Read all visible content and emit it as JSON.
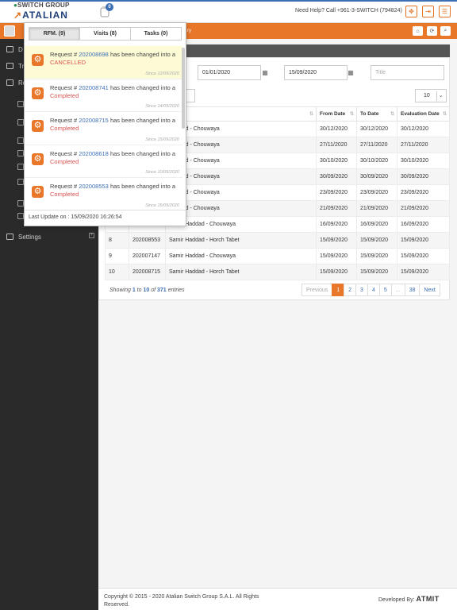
{
  "header": {
    "logo_line1": "SWITCH GROUP",
    "logo_line2": "ATALIAN",
    "notif_count": "0",
    "help_text": "Need Help? Call +961-3-SWITCH (794824)"
  },
  "orange_bar": {
    "partial_text": "ry"
  },
  "sidebar": {
    "items": [
      {
        "label": "D"
      },
      {
        "label": "Tr"
      },
      {
        "label": "Re"
      },
      {
        "label": "Settings"
      }
    ]
  },
  "filters": {
    "from_date": "01/01/2020",
    "to_date": "15/09/2020",
    "title_placeholder": "Title",
    "page_size": "10"
  },
  "table": {
    "columns": [
      "",
      "",
      "",
      "From Date",
      "To Date",
      "Evaluation Date"
    ],
    "rows": [
      [
        "",
        "",
        "Haddad - Chouwaya",
        "30/12/2020",
        "30/12/2020",
        "30/12/2020"
      ],
      [
        "",
        "",
        "Haddad - Chouwaya",
        "27/11/2020",
        "27/11/2020",
        "27/11/2020"
      ],
      [
        "",
        "",
        "Haddad - Chouwaya",
        "30/10/2020",
        "30/10/2020",
        "30/10/2020"
      ],
      [
        "",
        "",
        "Haddad - Chouwaya",
        "30/09/2020",
        "30/09/2020",
        "30/09/2020"
      ],
      [
        "",
        "",
        "Haddad - Chouwaya",
        "23/09/2020",
        "23/09/2020",
        "23/09/2020"
      ],
      [
        "",
        "",
        "Haddad - Chouwaya",
        "21/09/2020",
        "21/09/2020",
        "21/09/2020"
      ],
      [
        "7",
        "",
        "Samir Haddad - Chouwaya",
        "16/09/2020",
        "16/09/2020",
        "16/09/2020"
      ],
      [
        "8",
        "202008553",
        "Samir Haddad - Horch Tabet",
        "15/09/2020",
        "15/09/2020",
        "15/09/2020"
      ],
      [
        "9",
        "202007147",
        "Samir Haddad - Chouwaya",
        "15/09/2020",
        "15/09/2020",
        "15/09/2020"
      ],
      [
        "10",
        "202008715",
        "Samir Haddad - Horch Tabet",
        "15/09/2020",
        "15/09/2020",
        "15/09/2020"
      ]
    ]
  },
  "pagination": {
    "showing_prefix": "Showing",
    "from": "1",
    "to_word": "to",
    "to": "10",
    "of_word": "of",
    "total": "371",
    "entries_word": "entries",
    "pages": [
      "Previous",
      "1",
      "2",
      "3",
      "4",
      "5",
      "...",
      "38",
      "Next"
    ]
  },
  "notifications": {
    "tabs": [
      "RFM. (9)",
      "Visits (8)",
      "Tasks (0)"
    ],
    "items": [
      {
        "prefix": "Request #",
        "number": "202008698",
        "middle": "has been changed into a",
        "status": "CANCELLED",
        "since": "Since 12/09/2020"
      },
      {
        "prefix": "Request #",
        "number": "202008741",
        "middle": "has been changed into a",
        "status": "Completed",
        "since": "Since 14/09/2020"
      },
      {
        "prefix": "Request #",
        "number": "202008715",
        "middle": "has been changed into a",
        "status": "Completed",
        "since": "Since 15/09/2020"
      },
      {
        "prefix": "Request #",
        "number": "202008618",
        "middle": "has been changed into a",
        "status": "Completed",
        "since": "Since 10/09/2020"
      },
      {
        "prefix": "Request #",
        "number": "202008553",
        "middle": "has been changed into a",
        "status": "Completed",
        "since": "Since 15/09/2020"
      }
    ],
    "last_update": "Last Update on : 15/09/2020 16:26:54"
  },
  "footer": {
    "copyright": "Copyright © 2015 - 2020 Atalian Switch Group S.A.L. All Rights Reserved.",
    "developed_by": "Developed By:",
    "dev_brand": "ATMIT"
  },
  "colors": {
    "orange": "#e8772a",
    "blue": "#3d6fb5",
    "sidebar": "#2a2a2a"
  }
}
